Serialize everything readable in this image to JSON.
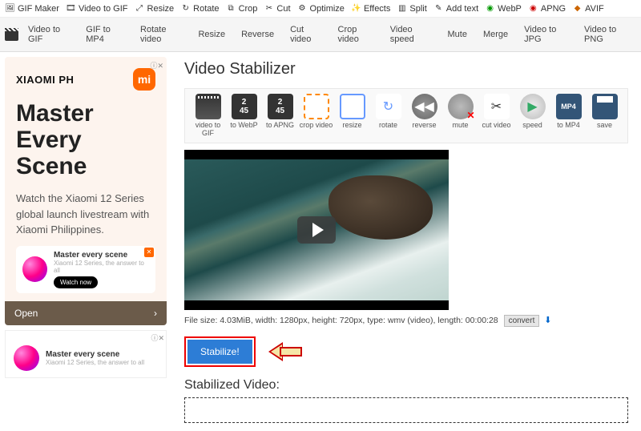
{
  "topnav": [
    {
      "label": "GIF Maker"
    },
    {
      "label": "Video to GIF"
    },
    {
      "label": "Resize"
    },
    {
      "label": "Rotate"
    },
    {
      "label": "Crop"
    },
    {
      "label": "Cut"
    },
    {
      "label": "Optimize"
    },
    {
      "label": "Effects"
    },
    {
      "label": "Split"
    },
    {
      "label": "Add text"
    },
    {
      "label": "WebP"
    },
    {
      "label": "APNG"
    },
    {
      "label": "AVIF"
    }
  ],
  "secnav": [
    "Video to GIF",
    "GIF to MP4",
    "Rotate video",
    "Resize",
    "Reverse",
    "Cut video",
    "Crop video",
    "Video speed",
    "Mute",
    "Merge",
    "Video to JPG",
    "Video to PNG"
  ],
  "ad": {
    "brand": "XIAOMI PH",
    "title": "Master Every Scene",
    "text": "Watch the Xiaomi 12 Series global launch livestream with Xiaomi Philippines.",
    "card_title": "Master every scene",
    "card_sub": "Xiaomi 12 Series, the answer to all",
    "watch": "Watch now",
    "open": "Open",
    "close_marker": "ⓘ✕"
  },
  "page": {
    "title": "Video Stabilizer",
    "stabilized_heading": "Stabilized Video:"
  },
  "tools": [
    {
      "name": "video-to-gif",
      "label": "video to GIF"
    },
    {
      "name": "to-webp",
      "label": "to WebP"
    },
    {
      "name": "to-apng",
      "label": "to APNG"
    },
    {
      "name": "crop-video",
      "label": "crop video"
    },
    {
      "name": "resize",
      "label": "resize"
    },
    {
      "name": "rotate",
      "label": "rotate"
    },
    {
      "name": "reverse",
      "label": "reverse"
    },
    {
      "name": "mute",
      "label": "mute"
    },
    {
      "name": "cut-video",
      "label": "cut video"
    },
    {
      "name": "speed",
      "label": "speed"
    },
    {
      "name": "to-mp4",
      "label": "to MP4"
    },
    {
      "name": "save",
      "label": "save"
    }
  ],
  "fileinfo": {
    "text": "File size: 4.03MiB, width: 1280px, height: 720px, type: wmv (video), length: 00:00:28",
    "convert": "convert",
    "download": "⬇"
  },
  "stabilize_btn": "Stabilize!"
}
